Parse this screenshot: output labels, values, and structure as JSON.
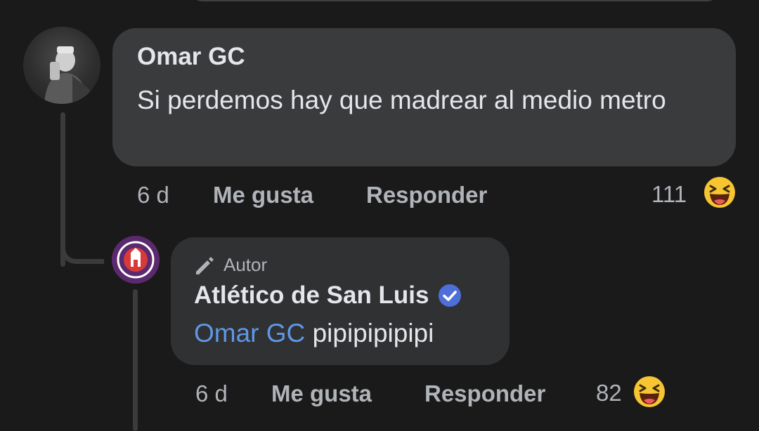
{
  "comment": {
    "author": "Omar GC",
    "text": "Si perdemos hay que madrear al medio metro",
    "time": "6 d",
    "like_label": "Me gusta",
    "reply_label": "Responder",
    "reaction_count": "111",
    "reaction_icon": "haha-emoji-icon"
  },
  "reply": {
    "badge_label": "Autor",
    "author": "Atlético de San Luis",
    "verified_icon": "verified-badge-icon",
    "mention": "Omar GC",
    "text": "pipipipipipi",
    "time": "6 d",
    "like_label": "Me gusta",
    "reply_label": "Responder",
    "reaction_count": "82",
    "reaction_icon": "haha-emoji-icon"
  },
  "colors": {
    "background": "#1a1a1b",
    "bubble": "#3a3b3c",
    "mention": "#5f97e5",
    "verified": "#4e6fd9",
    "haha": "#f7c531"
  }
}
